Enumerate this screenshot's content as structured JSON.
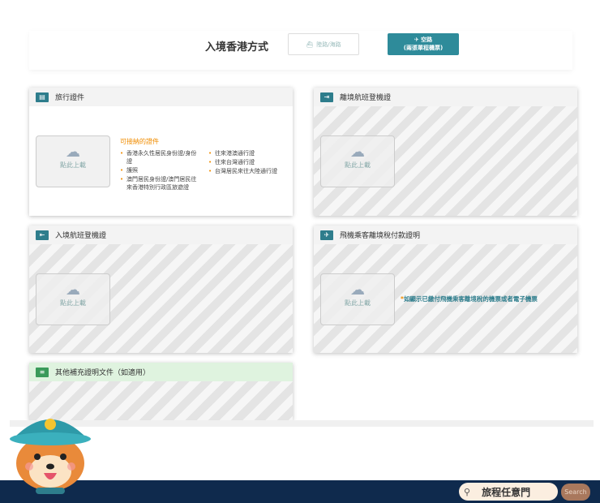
{
  "entry": {
    "title": "入境香港方式",
    "land_sea": "陸路/海路",
    "air": "空路",
    "air_sub": "(兩張單程機票)"
  },
  "cards": [
    {
      "title": "旅行證件",
      "upload": "點此上載",
      "docs_title": "可接納的證件",
      "docs_left": [
        "香港永久性居民身份證/身份證",
        "護照",
        "澳門居民身份證/澳門居民往來香港特別行政區旅遊證"
      ],
      "docs_right": [
        "往來港澳通行證",
        "往來台灣通行證",
        "台灣居民來往大陸通行證"
      ]
    },
    {
      "title": "離境航班登機證",
      "upload": "點此上載"
    },
    {
      "title": "入境航班登機證",
      "upload": "點此上載"
    },
    {
      "title": "飛機乘客離境稅付款證明",
      "upload": "點此上載",
      "note_mark": "*",
      "note": "如顯示已繳付飛機乘客離境稅的機票或者電子機票"
    },
    {
      "title": "其他補充證明文件（如適用）"
    }
  ],
  "footer": {
    "brand": "旅程任意門",
    "search": "Search"
  }
}
